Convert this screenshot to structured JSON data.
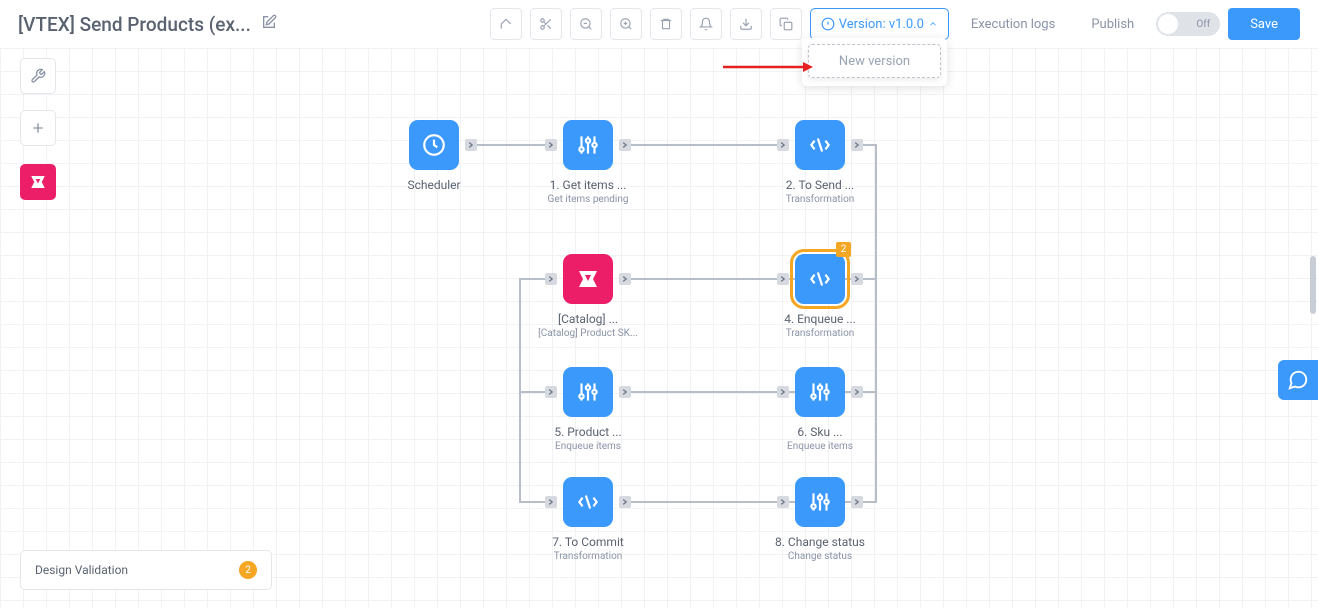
{
  "header": {
    "title": "[VTEX] Send Products (ex...",
    "version_label": "Version: v1.0.0",
    "new_version_label": "New version",
    "execution_logs": "Execution logs",
    "publish": "Publish",
    "toggle_label": "Off",
    "save": "Save"
  },
  "validation": {
    "label": "Design Validation",
    "count": "2"
  },
  "nodes": {
    "scheduler": {
      "label": "Scheduler",
      "sublabel": ""
    },
    "get_items": {
      "label": "1. Get items ...",
      "sublabel": "Get items pending"
    },
    "to_send": {
      "label": "2. To Send ...",
      "sublabel": "Transformation"
    },
    "catalog": {
      "label": "[Catalog] ...",
      "sublabel": "[Catalog] Product SK..."
    },
    "enqueue": {
      "label": "4. Enqueue ...",
      "sublabel": "Transformation",
      "badge": "2"
    },
    "product": {
      "label": "5. Product ...",
      "sublabel": "Enqueue items"
    },
    "sku": {
      "label": "6. Sku ...",
      "sublabel": "Enqueue items"
    },
    "to_commit": {
      "label": "7. To Commit",
      "sublabel": "Transformation"
    },
    "change_status": {
      "label": "8. Change status",
      "sublabel": "Change status"
    }
  },
  "colors": {
    "primary": "#3b99fc",
    "accent_pink": "#ec1e68",
    "warning": "#f5a623"
  }
}
